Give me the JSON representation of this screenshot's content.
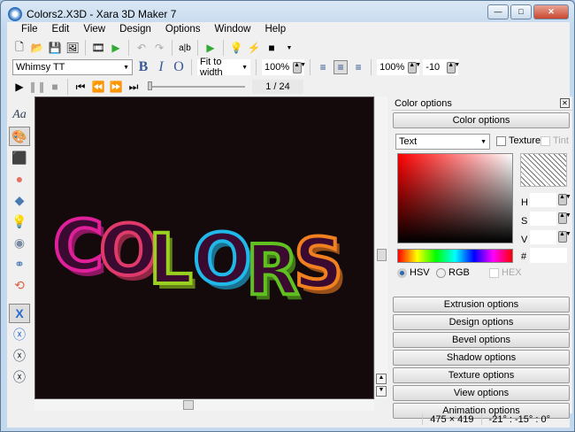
{
  "window": {
    "title": "Colors2.X3D - Xara 3D Maker 7",
    "min": "—",
    "max": "□",
    "close": "✕"
  },
  "menu": [
    "File",
    "Edit",
    "View",
    "Design",
    "Options",
    "Window",
    "Help"
  ],
  "format": {
    "font": "Whimsy TT",
    "bold": "B",
    "italic": "I",
    "outline": "O",
    "fit": "Fit to width",
    "size": "100%",
    "line_spacing": "100%",
    "char_spacing": "-10"
  },
  "playback": {
    "frame": "1 / 24"
  },
  "canvas": {
    "text": "COLORS",
    "letter_colors": [
      "#e0209a",
      "#e03a6a",
      "#9ad020",
      "#20b8e8",
      "#60c020",
      "#f08020"
    ]
  },
  "panel": {
    "title": "Color options",
    "section": "Color options",
    "target": "Text",
    "texture": "Texture",
    "tint": "Tint",
    "h": "H",
    "s": "S",
    "v": "V",
    "hash": "#",
    "hsv": "HSV",
    "rgb": "RGB",
    "hex": "HEX",
    "sections": [
      "Extrusion options",
      "Design options",
      "Bevel options",
      "Shadow options",
      "Texture options",
      "View options",
      "Animation options"
    ]
  },
  "status": {
    "size": "475 × 419",
    "angles": "-21° : -15° : 0°"
  }
}
